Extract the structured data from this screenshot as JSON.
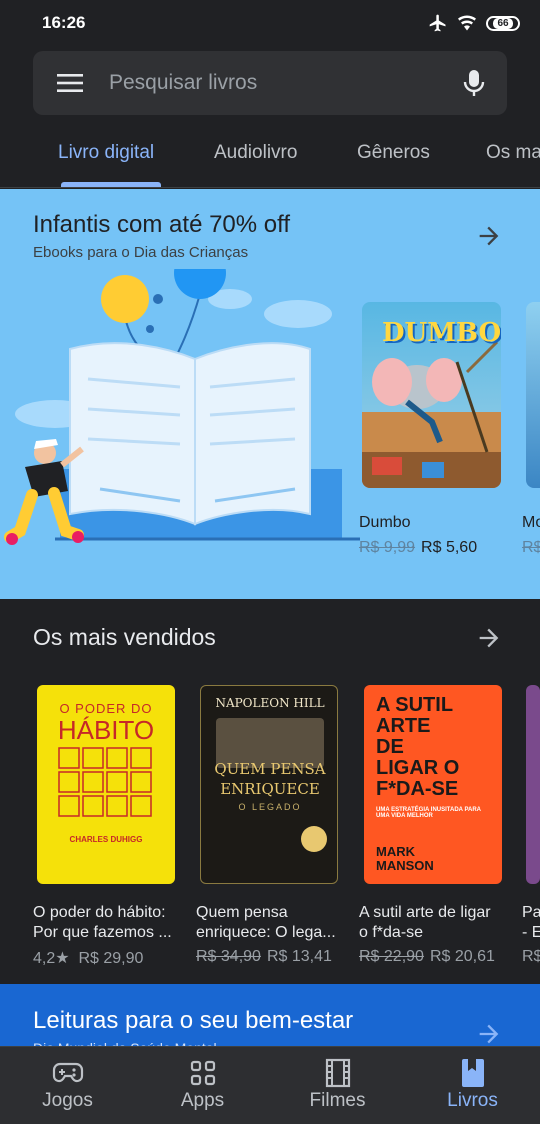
{
  "status": {
    "time": "16:26",
    "battery": "66"
  },
  "search": {
    "placeholder": "Pesquisar livros"
  },
  "tabs": [
    {
      "label": "Livro digital",
      "active": true
    },
    {
      "label": "Audiolivro"
    },
    {
      "label": "Gêneros"
    },
    {
      "label": "Os ma"
    }
  ],
  "promo": {
    "title": "Infantis com até 70% off",
    "subtitle": "Ebooks para o Dia das Crianças",
    "cover_text": "DUMBO",
    "books": [
      {
        "title": "Dumbo",
        "old_price": "R$ 9,99",
        "price": "R$ 5,60"
      },
      {
        "title": "Mo",
        "old_price": "R$"
      }
    ]
  },
  "bestsellers": {
    "title": "Os mais vendidos",
    "books": [
      {
        "line1": "O poder do hábito:",
        "line2": "Por que fazemos ...",
        "rating": "4,2★",
        "price": "R$ 29,90",
        "cover_top": "O PODER DO",
        "cover_main": "HÁBITO",
        "cover_author": "CHARLES DUHIGG"
      },
      {
        "line1": "Quem pensa",
        "line2": "enriquece: O lega...",
        "old_price": "R$ 34,90",
        "price": "R$ 13,41",
        "cover_top": "NAPOLEON HILL",
        "cover_main1": "QUEM PENSA",
        "cover_main2": "ENRIQUECE",
        "cover_sub": "O LEGADO"
      },
      {
        "line1": "A sutil arte de ligar",
        "line2": "o f*da-se",
        "old_price": "R$ 22,90",
        "price": "R$ 20,61",
        "cover_l1": "A SUTIL",
        "cover_l2": "ARTE",
        "cover_l3": "DE",
        "cover_l4": "LIGAR O",
        "cover_l5": "F*DA-SE",
        "cover_sub": "UMA ESTRATÉGIA INUSITADA PARA UMA VIDA MELHOR",
        "cover_a1": "MARK",
        "cover_a2": "MANSON"
      },
      {
        "line1": "Pa",
        "line2": "- E",
        "price": "R$"
      }
    ]
  },
  "wellness": {
    "title": "Leituras para o seu bem-estar",
    "subtitle": "Dia Mundial da Saúde Mental"
  },
  "nav": [
    {
      "label": "Jogos",
      "icon": "gamepad-icon"
    },
    {
      "label": "Apps",
      "icon": "apps-grid-icon"
    },
    {
      "label": "Filmes",
      "icon": "film-icon"
    },
    {
      "label": "Livros",
      "icon": "bookmark-book-icon",
      "active": true
    }
  ],
  "colors": {
    "accent": "#8ab4f8",
    "promo_bg": "#75c3f6",
    "wellness_bg": "#1967d2"
  }
}
